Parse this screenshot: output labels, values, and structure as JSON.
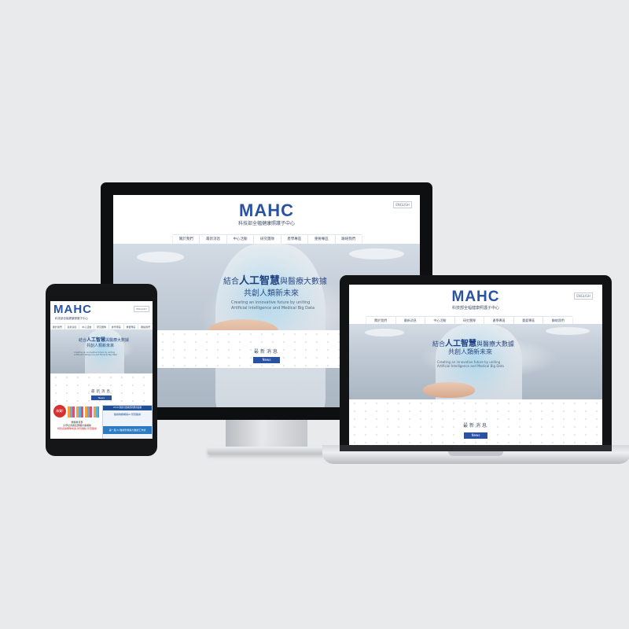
{
  "site": {
    "logo": "MAHC",
    "subtitle": "科技部全幅健康照護子中心",
    "language_button": "ENGLISH",
    "nav": [
      "關於我們",
      "最新消息",
      "中心活動",
      "研究團隊",
      "產學專區",
      "重要專區",
      "聯絡我們"
    ],
    "hero": {
      "line1_prefix": "結合",
      "line1_bold": "人工智慧",
      "line1_suffix": "與醫療大數據",
      "line2": "共創人類新未來",
      "en_line1": "Creating an innovative future by uniting",
      "en_line2": "Artificial Intelligence and Medical Big Data"
    },
    "news_heading": "最新消息",
    "news_button": "News"
  },
  "tablet_extra": {
    "badge": "恭賀!",
    "promo_caption": "2019 健康大數據創新應用競賽",
    "promo_heading": "醫療物聯網與AI 智慧醫療",
    "promo_banner": "第一屆 AI 醫療影像與大數據工作坊",
    "award_text_1": "榮獲教育部",
    "award_text_2": "大學社會責任實踐計畫補助",
    "award_text_3": "特別感謝團隊成員 熱烈推動 智慧醫療"
  },
  "colors": {
    "brand_blue": "#2a52a3",
    "accent_gold": "#e3a12f",
    "background": "#e9eaec"
  }
}
